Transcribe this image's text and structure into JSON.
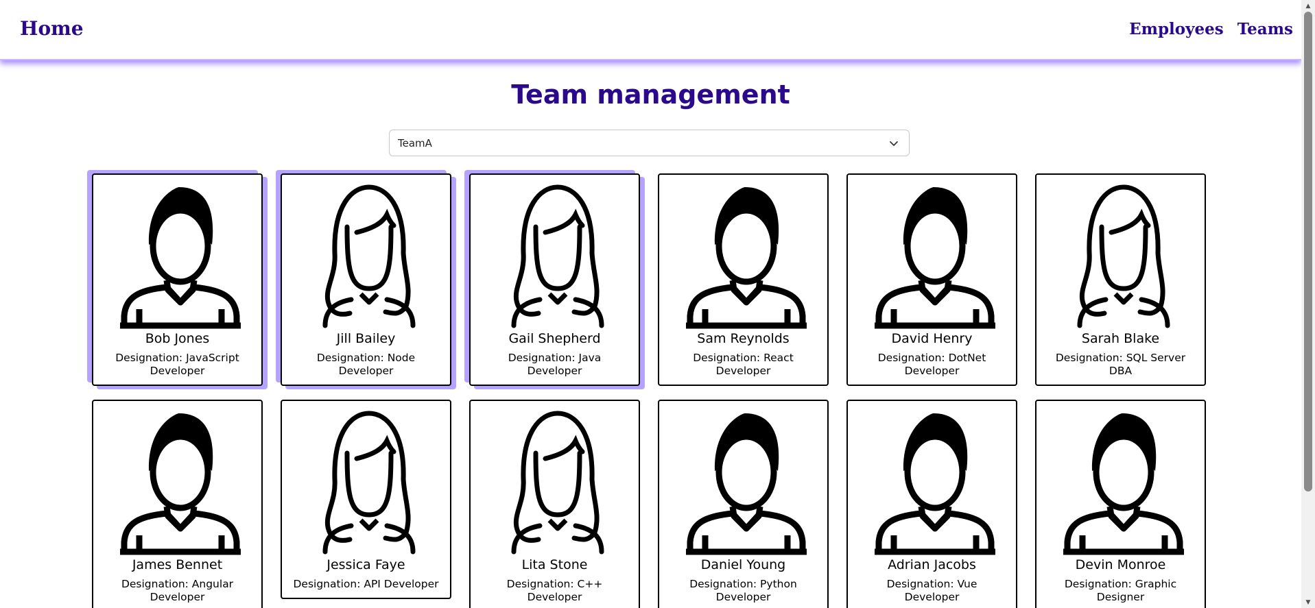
{
  "nav": {
    "home": "Home",
    "links": [
      "Employees",
      "Teams"
    ]
  },
  "page": {
    "title": "Team management"
  },
  "team_select": {
    "value": "TeamA"
  },
  "employees": [
    {
      "name": "Bob Jones",
      "designation": "Designation: JavaScript Developer",
      "gender": "male",
      "selected": true
    },
    {
      "name": "Jill Bailey",
      "designation": "Designation: Node Developer",
      "gender": "female",
      "selected": true
    },
    {
      "name": "Gail Shepherd",
      "designation": "Designation: Java Developer",
      "gender": "female",
      "selected": true
    },
    {
      "name": "Sam Reynolds",
      "designation": "Designation: React Developer",
      "gender": "male",
      "selected": false
    },
    {
      "name": "David Henry",
      "designation": "Designation: DotNet Developer",
      "gender": "male",
      "selected": false
    },
    {
      "name": "Sarah Blake",
      "designation": "Designation: SQL Server DBA",
      "gender": "female",
      "selected": false
    },
    {
      "name": "James Bennet",
      "designation": "Designation: Angular Developer",
      "gender": "male",
      "selected": false
    },
    {
      "name": "Jessica Faye",
      "designation": "Designation: API Developer",
      "gender": "female",
      "selected": false
    },
    {
      "name": "Lita Stone",
      "designation": "Designation: C++ Developer",
      "gender": "female",
      "selected": false
    },
    {
      "name": "Daniel Young",
      "designation": "Designation: Python Developer",
      "gender": "male",
      "selected": false
    },
    {
      "name": "Adrian Jacobs",
      "designation": "Designation: Vue Developer",
      "gender": "male",
      "selected": false
    },
    {
      "name": "Devin Monroe",
      "designation": "Designation: Graphic Designer",
      "gender": "male",
      "selected": false
    }
  ],
  "icons": {
    "male": "male-avatar-icon",
    "female": "female-avatar-icon",
    "select": "chevron-down-icon"
  },
  "colors": {
    "brand": "#2a0a8a",
    "selected_highlight": "#b6a3ff"
  }
}
